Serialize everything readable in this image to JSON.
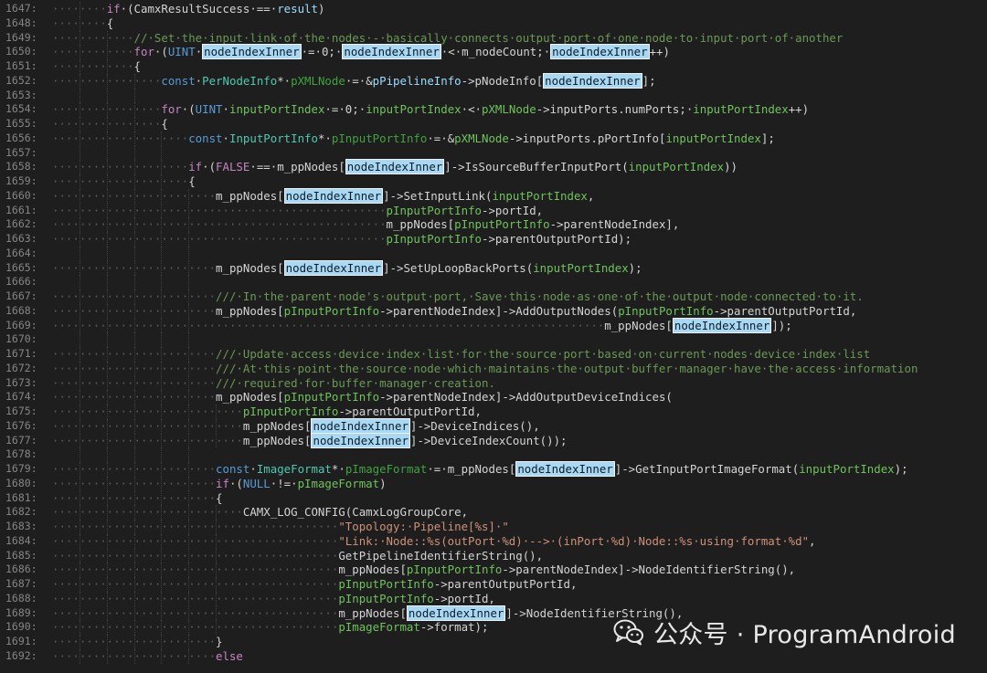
{
  "editor": {
    "lines": [
      {
        "n": "1647:",
        "d": 2,
        "t": [
          [
            "kwp",
            "if"
          ],
          [
            "pl",
            "·(CamxResultSuccess·==·"
          ],
          [
            "var",
            "result"
          ],
          [
            "pl",
            ")"
          ]
        ]
      },
      {
        "n": "1648:",
        "d": 2,
        "t": [
          [
            "pl",
            "{"
          ]
        ]
      },
      {
        "n": "1649:",
        "d": 3,
        "t": [
          [
            "cm",
            "//·Set·the·input·link·of·the·nodes·-·basically·connects·output·port·of·one·node·to·input·port·of·another"
          ]
        ]
      },
      {
        "n": "1650:",
        "d": 3,
        "t": [
          [
            "kwp",
            "for"
          ],
          [
            "pl",
            "·("
          ],
          [
            "kw",
            "UINT"
          ],
          [
            "pl",
            "·"
          ],
          [
            "hl",
            "nodeIndexInner"
          ],
          [
            "pl",
            "·=·0;·"
          ],
          [
            "hl",
            "nodeIndexInner"
          ],
          [
            "pl",
            "·<·m_nodeCount;·"
          ],
          [
            "hl",
            "nodeIndexInner"
          ],
          [
            "pl",
            "++)"
          ]
        ]
      },
      {
        "n": "1651:",
        "d": 3,
        "t": [
          [
            "pl",
            "{"
          ]
        ]
      },
      {
        "n": "1652:",
        "d": 4,
        "t": [
          [
            "kw",
            "const"
          ],
          [
            "pl",
            "·"
          ],
          [
            "typ",
            "PerNodeInfo"
          ],
          [
            "pl",
            "*·"
          ],
          [
            "lcl",
            "pXMLNode"
          ],
          [
            "pl",
            "·=·&"
          ],
          [
            "var",
            "pPipelineInfo"
          ],
          [
            "pl",
            "->pNodeInfo["
          ],
          [
            "hl",
            "nodeIndexInner"
          ],
          [
            "pl",
            "];"
          ]
        ]
      },
      {
        "n": "1653:",
        "d": 4,
        "t": []
      },
      {
        "n": "1654:",
        "d": 4,
        "t": [
          [
            "kwp",
            "for"
          ],
          [
            "pl",
            "·("
          ],
          [
            "kw",
            "UINT"
          ],
          [
            "pl",
            "·"
          ],
          [
            "prm",
            "inputPortIndex"
          ],
          [
            "pl",
            "·=·0;·"
          ],
          [
            "prm",
            "inputPortIndex"
          ],
          [
            "pl",
            "·<·"
          ],
          [
            "prm",
            "pXMLNode"
          ],
          [
            "pl",
            "->inputPorts.numPorts;·"
          ],
          [
            "prm",
            "inputPortIndex"
          ],
          [
            "pl",
            "++)"
          ]
        ]
      },
      {
        "n": "1655:",
        "d": 4,
        "t": [
          [
            "pl",
            "{"
          ]
        ]
      },
      {
        "n": "1656:",
        "d": 5,
        "t": [
          [
            "kw",
            "const"
          ],
          [
            "pl",
            "·"
          ],
          [
            "typ",
            "InputPortInfo"
          ],
          [
            "pl",
            "*·"
          ],
          [
            "lcl",
            "pInputPortInfo"
          ],
          [
            "pl",
            "·=·&"
          ],
          [
            "prm",
            "pXMLNode"
          ],
          [
            "pl",
            "->inputPorts.pPortInfo["
          ],
          [
            "prm",
            "inputPortIndex"
          ],
          [
            "pl",
            "];"
          ]
        ]
      },
      {
        "n": "1657:",
        "d": 5,
        "t": []
      },
      {
        "n": "1658:",
        "d": 5,
        "t": [
          [
            "kwp",
            "if"
          ],
          [
            "pl",
            "·("
          ],
          [
            "kwp",
            "FALSE"
          ],
          [
            "pl",
            "·==·m_ppNodes["
          ],
          [
            "hl",
            "nodeIndexInner"
          ],
          [
            "pl",
            "]->IsSourceBufferInputPort("
          ],
          [
            "prm",
            "inputPortIndex"
          ],
          [
            "pl",
            "))"
          ]
        ]
      },
      {
        "n": "1659:",
        "d": 5,
        "t": [
          [
            "pl",
            "{"
          ]
        ]
      },
      {
        "n": "1660:",
        "d": 6,
        "t": [
          [
            "pl",
            "m_ppNodes["
          ],
          [
            "hl",
            "nodeIndexInner"
          ],
          [
            "pl",
            "]->SetInputLink("
          ],
          [
            "prm",
            "inputPortIndex"
          ],
          [
            "pl",
            ","
          ]
        ]
      },
      {
        "n": "1661:",
        "d": 6,
        "t": [
          [
            "ws",
            "·························"
          ],
          [
            "prm",
            "pInputPortInfo"
          ],
          [
            "pl",
            "->portId,"
          ]
        ]
      },
      {
        "n": "1662:",
        "d": 6,
        "t": [
          [
            "ws",
            "·························"
          ],
          [
            "pl",
            "m_ppNodes["
          ],
          [
            "prm",
            "pInputPortInfo"
          ],
          [
            "pl",
            "->parentNodeIndex],"
          ]
        ]
      },
      {
        "n": "1663:",
        "d": 6,
        "t": [
          [
            "ws",
            "·························"
          ],
          [
            "prm",
            "pInputPortInfo"
          ],
          [
            "pl",
            "->parentOutputPortId);"
          ]
        ]
      },
      {
        "n": "1664:",
        "d": 6,
        "t": []
      },
      {
        "n": "1665:",
        "d": 6,
        "t": [
          [
            "pl",
            "m_ppNodes["
          ],
          [
            "hl",
            "nodeIndexInner"
          ],
          [
            "pl",
            "]->SetUpLoopBackPorts("
          ],
          [
            "prm",
            "inputPortIndex"
          ],
          [
            "pl",
            ");"
          ]
        ]
      },
      {
        "n": "1666:",
        "d": 6,
        "t": []
      },
      {
        "n": "1667:",
        "d": 6,
        "t": [
          [
            "cm",
            "///·In·the·parent·node's·output·port,·Save·this·node·as·one·of·the·output·node·connected·to·it."
          ]
        ]
      },
      {
        "n": "1668:",
        "d": 6,
        "t": [
          [
            "pl",
            "m_ppNodes["
          ],
          [
            "prm",
            "pInputPortInfo"
          ],
          [
            "pl",
            "->parentNodeIndex]->AddOutputNodes("
          ],
          [
            "prm",
            "pInputPortInfo"
          ],
          [
            "pl",
            "->parentOutputPortId,"
          ]
        ]
      },
      {
        "n": "1669:",
        "d": 6,
        "t": [
          [
            "ws",
            "·························································"
          ],
          [
            "pl",
            "m_ppNodes["
          ],
          [
            "hl",
            "nodeIndexInner"
          ],
          [
            "pl",
            "]);"
          ]
        ]
      },
      {
        "n": "1670:",
        "d": 6,
        "t": []
      },
      {
        "n": "1671:",
        "d": 6,
        "t": [
          [
            "cm",
            "///·Update·access·device·index·list·for·the·source·port·based·on·current·nodes·device·index·list"
          ]
        ]
      },
      {
        "n": "1672:",
        "d": 6,
        "t": [
          [
            "cm",
            "///·At·this·point·the·source·node·which·maintains·the·output·buffer·manager·have·the·access·information"
          ]
        ]
      },
      {
        "n": "1673:",
        "d": 6,
        "t": [
          [
            "cm",
            "///·required·for·buffer·manager·creation."
          ]
        ]
      },
      {
        "n": "1674:",
        "d": 6,
        "t": [
          [
            "pl",
            "m_ppNodes["
          ],
          [
            "prm",
            "pInputPortInfo"
          ],
          [
            "pl",
            "->parentNodeIndex]->AddOutputDeviceIndices("
          ]
        ]
      },
      {
        "n": "1675:",
        "d": 7,
        "t": [
          [
            "prm",
            "pInputPortInfo"
          ],
          [
            "pl",
            "->parentOutputPortId,"
          ]
        ]
      },
      {
        "n": "1676:",
        "d": 7,
        "t": [
          [
            "pl",
            "m_ppNodes["
          ],
          [
            "hl",
            "nodeIndexInner"
          ],
          [
            "pl",
            "]->DeviceIndices(),"
          ]
        ]
      },
      {
        "n": "1677:",
        "d": 7,
        "t": [
          [
            "pl",
            "m_ppNodes["
          ],
          [
            "hl",
            "nodeIndexInner"
          ],
          [
            "pl",
            "]->DeviceIndexCount());"
          ]
        ]
      },
      {
        "n": "1678:",
        "d": 6,
        "t": []
      },
      {
        "n": "1679:",
        "d": 6,
        "t": [
          [
            "kw",
            "const"
          ],
          [
            "pl",
            "·"
          ],
          [
            "typ",
            "ImageFormat"
          ],
          [
            "pl",
            "*·"
          ],
          [
            "lcl",
            "pImageFormat"
          ],
          [
            "pl",
            "·=·m_ppNodes["
          ],
          [
            "hl",
            "nodeIndexInner"
          ],
          [
            "pl",
            "]->GetInputPortImageFormat("
          ],
          [
            "prm",
            "inputPortIndex"
          ],
          [
            "pl",
            ");"
          ]
        ]
      },
      {
        "n": "1680:",
        "d": 6,
        "t": [
          [
            "kwp",
            "if"
          ],
          [
            "pl",
            "·("
          ],
          [
            "kw",
            "NULL"
          ],
          [
            "pl",
            "·!=·"
          ],
          [
            "prm",
            "pImageFormat"
          ],
          [
            "pl",
            ")"
          ]
        ]
      },
      {
        "n": "1681:",
        "d": 6,
        "t": [
          [
            "pl",
            "{"
          ]
        ]
      },
      {
        "n": "1682:",
        "d": 7,
        "t": [
          [
            "pl",
            "CAMX_LOG_CONFIG(CamxLogGroupCore,"
          ]
        ]
      },
      {
        "n": "1683:",
        "d": 7,
        "t": [
          [
            "ws",
            "··············"
          ],
          [
            "str",
            "\"Topology:·Pipeline[%s]·\""
          ]
        ]
      },
      {
        "n": "1684:",
        "d": 7,
        "t": [
          [
            "ws",
            "··············"
          ],
          [
            "str",
            "\"Link:·Node::%s(outPort·%d)·-->·(inPort·%d)·Node::%s·using·format·%d\""
          ],
          [
            "pl",
            ","
          ]
        ]
      },
      {
        "n": "1685:",
        "d": 7,
        "t": [
          [
            "ws",
            "··············"
          ],
          [
            "pl",
            "GetPipelineIdentifierString(),"
          ]
        ]
      },
      {
        "n": "1686:",
        "d": 7,
        "t": [
          [
            "ws",
            "··············"
          ],
          [
            "pl",
            "m_ppNodes["
          ],
          [
            "prm",
            "pInputPortInfo"
          ],
          [
            "pl",
            "->parentNodeIndex]->NodeIdentifierString(),"
          ]
        ]
      },
      {
        "n": "1687:",
        "d": 7,
        "t": [
          [
            "ws",
            "··············"
          ],
          [
            "prm",
            "pInputPortInfo"
          ],
          [
            "pl",
            "->parentOutputPortId,"
          ]
        ]
      },
      {
        "n": "1688:",
        "d": 7,
        "t": [
          [
            "ws",
            "··············"
          ],
          [
            "prm",
            "pInputPortInfo"
          ],
          [
            "pl",
            "->portId,"
          ]
        ]
      },
      {
        "n": "1689:",
        "d": 7,
        "t": [
          [
            "ws",
            "··············"
          ],
          [
            "pl",
            "m_ppNodes["
          ],
          [
            "hl",
            "nodeIndexInner"
          ],
          [
            "pl",
            "]->NodeIdentifierString(),"
          ]
        ]
      },
      {
        "n": "1690:",
        "d": 7,
        "t": [
          [
            "ws",
            "··············"
          ],
          [
            "prm",
            "pImageFormat"
          ],
          [
            "pl",
            "->format);"
          ]
        ]
      },
      {
        "n": "1691:",
        "d": 6,
        "t": [
          [
            "pl",
            "}"
          ]
        ]
      },
      {
        "n": "1692:",
        "d": 6,
        "t": [
          [
            "kwp",
            "else"
          ]
        ]
      }
    ]
  },
  "watermark": {
    "icon": "wechat-icon",
    "text": "公众号 · ProgramAndroid"
  }
}
